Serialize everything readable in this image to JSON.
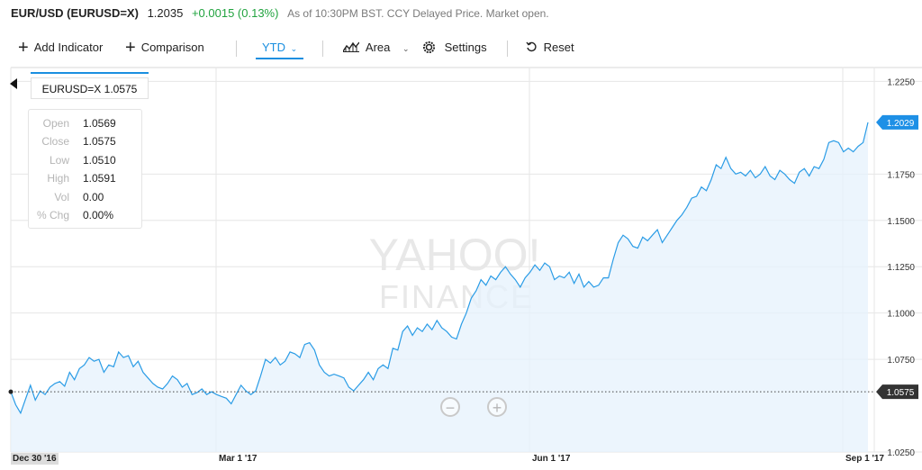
{
  "header": {
    "symbol": "EUR/USD (EURUSD=X)",
    "price": "1.2035",
    "change": "+0.0015 (0.13%)",
    "as_of": "As of 10:30PM BST. CCY Delayed Price. Market open."
  },
  "toolbar": {
    "add_indicator": "Add Indicator",
    "comparison": "Comparison",
    "range": "YTD",
    "chart_type": "Area",
    "settings": "Settings",
    "reset": "Reset"
  },
  "tooltip": {
    "title": "EURUSD=X 1.0575",
    "rows": [
      {
        "label": "Open",
        "value": "1.0569"
      },
      {
        "label": "Close",
        "value": "1.0575"
      },
      {
        "label": "Low",
        "value": "1.0510"
      },
      {
        "label": "High",
        "value": "1.0591"
      },
      {
        "label": "Vol",
        "value": "0.00"
      },
      {
        "label": "% Chg",
        "value": "0.00%"
      }
    ]
  },
  "watermark": {
    "line1": "YAHOO!",
    "line2": "FINANCE"
  },
  "colors": {
    "line": "#2a9ce6",
    "fill": "#e6f2fc",
    "badge": "#1e90e6",
    "positive": "#21a33f"
  },
  "chart_data": {
    "type": "area",
    "title": "EUR/USD (EURUSD=X)",
    "xlabel": "",
    "ylabel": "",
    "ylim": [
      1.025,
      1.2325
    ],
    "y_ticks": [
      "1.2250",
      "1.1750",
      "1.1500",
      "1.1250",
      "1.1000",
      "1.0750",
      "1.0250"
    ],
    "x_ticks": [
      "Dec 30 '16",
      "Mar 1 '17",
      "Jun 1 '17",
      "Sep 1 '17"
    ],
    "last_value_label": "1.2029",
    "crosshair_value_label": "1.0575",
    "crosshair_value": 1.0575,
    "grid": true,
    "series": [
      {
        "values": [
          1.0575,
          1.0505,
          1.046,
          1.0535,
          1.061,
          1.053,
          1.058,
          1.056,
          1.06,
          1.062,
          1.063,
          1.0605,
          1.068,
          1.064,
          1.07,
          1.072,
          1.076,
          1.074,
          1.075,
          1.068,
          1.072,
          1.071,
          1.079,
          1.076,
          1.077,
          1.071,
          1.074,
          1.068,
          1.065,
          1.062,
          1.06,
          1.059,
          1.062,
          1.066,
          1.064,
          1.06,
          1.062,
          1.056,
          1.057,
          1.059,
          1.056,
          1.0575,
          1.056,
          1.055,
          1.054,
          1.051,
          1.056,
          1.061,
          1.058,
          1.056,
          1.058,
          1.066,
          1.075,
          1.073,
          1.076,
          1.072,
          1.074,
          1.079,
          1.078,
          1.076,
          1.083,
          1.084,
          1.08,
          1.072,
          1.068,
          1.066,
          1.067,
          1.066,
          1.065,
          1.06,
          1.058,
          1.061,
          1.064,
          1.068,
          1.064,
          1.07,
          1.072,
          1.07,
          1.081,
          1.08,
          1.09,
          1.093,
          1.088,
          1.092,
          1.09,
          1.094,
          1.091,
          1.096,
          1.092,
          1.09,
          1.087,
          1.086,
          1.094,
          1.1,
          1.108,
          1.112,
          1.118,
          1.115,
          1.12,
          1.118,
          1.122,
          1.125,
          1.121,
          1.118,
          1.114,
          1.119,
          1.122,
          1.126,
          1.123,
          1.127,
          1.125,
          1.118,
          1.12,
          1.119,
          1.122,
          1.116,
          1.121,
          1.114,
          1.117,
          1.114,
          1.115,
          1.119,
          1.119,
          1.129,
          1.138,
          1.142,
          1.14,
          1.136,
          1.135,
          1.141,
          1.139,
          1.142,
          1.145,
          1.138,
          1.142,
          1.146,
          1.15,
          1.153,
          1.157,
          1.162,
          1.163,
          1.168,
          1.166,
          1.172,
          1.18,
          1.178,
          1.184,
          1.178,
          1.175,
          1.176,
          1.174,
          1.177,
          1.173,
          1.175,
          1.179,
          1.174,
          1.172,
          1.177,
          1.175,
          1.172,
          1.17,
          1.176,
          1.178,
          1.174,
          1.179,
          1.178,
          1.183,
          1.192,
          1.193,
          1.192,
          1.187,
          1.189,
          1.187,
          1.19,
          1.192,
          1.2029
        ]
      }
    ]
  }
}
